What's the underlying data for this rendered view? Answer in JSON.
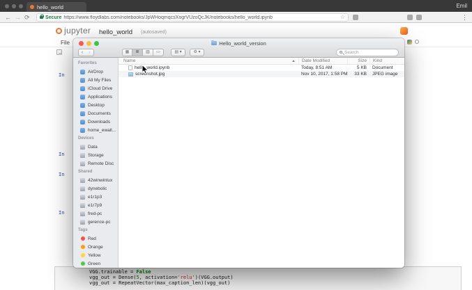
{
  "chrome": {
    "profile_name": "Emil",
    "tab_title": "hello_world",
    "secure_label": "Secure",
    "url": "https://www.floydlabs.com/notebooks/JpWHoqmqcsXogrVUzoQcJK/notebooks/hello_world.ipynb"
  },
  "icons": {
    "back": "←",
    "forward": "→",
    "refresh": "⟳",
    "bookmark_star": "☆",
    "menu_dots": "⋮",
    "finder_back": "‹",
    "finder_forward": "›",
    "view_grid": "▦",
    "view_list": "≣",
    "view_columns": "▥",
    "view_flow": "▭",
    "arrange": "▤ ▾",
    "gear": "⚙ ▾"
  },
  "jupyter": {
    "logo_text": "jupyter",
    "notebook_title": "hello_world",
    "autosave_status": "(autosaved)",
    "file_menu": "File",
    "cell_prompts": [
      "In",
      "In",
      "In",
      "In"
    ],
    "code_lines": [
      [
        {
          "t": "VGG.trainable = "
        },
        {
          "t": "False",
          "c": "kw"
        }
      ],
      [
        {
          "t": "vgg_out = Dense("
        },
        {
          "t": "5",
          "c": "num"
        },
        {
          "t": ", activation="
        },
        {
          "t": "'relu'",
          "c": "str"
        },
        {
          "t": ")(VGG.output)"
        }
      ],
      [
        {
          "t": "vgg_out = RepeatVector(max_caption_len)(vgg_out)"
        }
      ]
    ]
  },
  "finder": {
    "window_title": "Hello_world_version",
    "search_placeholder": "Search",
    "columns": [
      "Name",
      "Date Modified",
      "Size",
      "Kind"
    ],
    "sidebar": [
      {
        "title": "Favorites",
        "items": [
          {
            "label": "AirDrop",
            "icon": "airdrop-icon",
            "type": "fav"
          },
          {
            "label": "All My Files",
            "icon": "all-my-files-icon",
            "type": "fav"
          },
          {
            "label": "iCloud Drive",
            "icon": "icloud-drive-icon",
            "type": "fav"
          },
          {
            "label": "Applications",
            "icon": "applications-icon",
            "type": "fav"
          },
          {
            "label": "Desktop",
            "icon": "desktop-icon",
            "type": "fav"
          },
          {
            "label": "Documents",
            "icon": "documents-icon",
            "type": "fav"
          },
          {
            "label": "Downloads",
            "icon": "downloads-icon",
            "type": "fav"
          },
          {
            "label": "home_ewall...",
            "icon": "home-folder-icon",
            "type": "fav"
          }
        ]
      },
      {
        "title": "Devices",
        "items": [
          {
            "label": "Data",
            "icon": "disk-icon",
            "type": "dev"
          },
          {
            "label": "Storage",
            "icon": "disk-icon",
            "type": "dev"
          },
          {
            "label": "Remote Disc",
            "icon": "remote-disc-icon",
            "type": "dev"
          }
        ]
      },
      {
        "title": "Shared",
        "items": [
          {
            "label": "42winwintux",
            "icon": "shared-computer-icon",
            "type": "dev"
          },
          {
            "label": "dynebolic",
            "icon": "shared-computer-icon",
            "type": "dev"
          },
          {
            "label": "e1r1p3",
            "icon": "shared-computer-icon",
            "type": "dev"
          },
          {
            "label": "e1r7p9",
            "icon": "shared-computer-icon",
            "type": "dev"
          },
          {
            "label": "fred-pc",
            "icon": "shared-computer-icon",
            "type": "dev"
          },
          {
            "label": "gerence-pc",
            "icon": "shared-computer-icon",
            "type": "dev"
          }
        ]
      },
      {
        "title": "Tags",
        "items": [
          {
            "label": "Red",
            "icon": "tag-red-icon",
            "type": "tag",
            "color": "#ff4f43"
          },
          {
            "label": "Orange",
            "icon": "tag-orange-icon",
            "type": "tag",
            "color": "#ff9d0a"
          },
          {
            "label": "Yellow",
            "icon": "tag-yellow-icon",
            "type": "tag",
            "color": "#ffd633"
          },
          {
            "label": "Green",
            "icon": "tag-green-icon",
            "type": "tag",
            "color": "#55c648"
          }
        ]
      }
    ],
    "files": [
      {
        "name": "hello_world.ipynb",
        "modified": "Today, 8:51 AM",
        "size": "5 KB",
        "kind": "Document",
        "icon": "document-file-icon"
      },
      {
        "name": "screenshot.jpg",
        "modified": "Nov 10, 2017, 1:58 PM",
        "size": "33 KB",
        "kind": "JPEG image",
        "icon": "image-file-icon"
      }
    ]
  }
}
